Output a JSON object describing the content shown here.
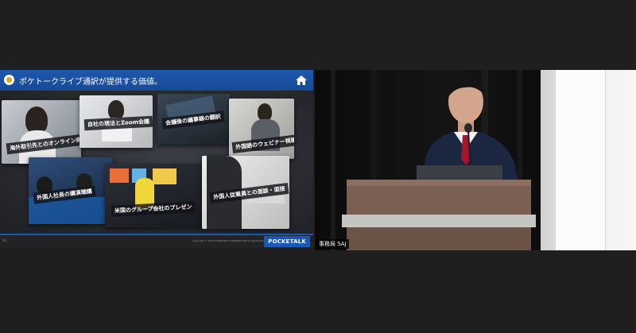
{
  "slide": {
    "title": "ポケトークライブ通訳が提供する価値。",
    "captions": [
      "海外取引先とのオンライン商談",
      "自社の現法とZoom会議",
      "会議後の議事録の翻訳",
      "外国語のウェビナー視聴",
      "外国人社長の講演聴講",
      "米国のグループ会社のプレゼン",
      "外国人従業員との面談・面接"
    ],
    "page_number": "20",
    "copyright": "Copyright © 2024 POCKETALK CORPORATION All Rights Reserved.",
    "brand": "POCKETALK"
  },
  "camera": {
    "participant_name": "事務局 SAJ"
  },
  "colors": {
    "slide_header": "#1e58ad",
    "brand_blue": "#1c57b3",
    "meeting_background": "#1f1f1f"
  }
}
